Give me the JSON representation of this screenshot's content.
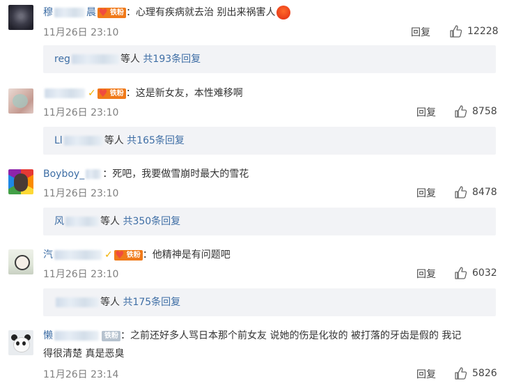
{
  "comments": [
    {
      "username": "穆",
      "username_tail": "晨",
      "fan_badge": "铁粉",
      "text": "：心理有疾病就去治 别出来祸害人",
      "time": "11月26日 23:10",
      "reply_label": "回复",
      "likes": "12228",
      "subreplies": {
        "who": "reg",
        "suffix": "等人",
        "link": "共193条回复"
      }
    },
    {
      "username": "",
      "fan_badge": "铁粉",
      "text": "：这是新女友，本性难移啊",
      "time": "11月26日 23:10",
      "reply_label": "回复",
      "likes": "8758",
      "subreplies": {
        "who": "Ll",
        "suffix": "等人",
        "link": "共165条回复"
      }
    },
    {
      "username": "Boyboy_",
      "text": "：死吧，我要做雪崩时最大的雪花",
      "time": "11月26日 23:10",
      "reply_label": "回复",
      "likes": "8478",
      "subreplies": {
        "who": "风",
        "suffix": "等人",
        "link": "共350条回复"
      }
    },
    {
      "username": "汽",
      "fan_badge": "铁粉",
      "text": "：他精神是有问题吧",
      "time": "11月26日 23:10",
      "reply_label": "回复",
      "likes": "6032",
      "subreplies": {
        "who": "",
        "suffix": "等人",
        "link": "共175条回复"
      }
    },
    {
      "username": "懒",
      "fan_badge": "铁粉",
      "text": "：之前还好多人骂日本那个前女友 说她的伤是化妆的 被打落的牙齿是假的 我记",
      "text_line2": "得很清楚 真是恶臭",
      "time": "11月26日 23:14",
      "reply_label": "回复",
      "likes": "5826"
    }
  ],
  "colors": {
    "link": "#3e6ea5",
    "meta": "#808080",
    "subreply_bg": "#f2f3f6",
    "fan_badge": "#f07a1a"
  },
  "icons": [
    "thumbs-up-icon",
    "heart-icon",
    "verified-icon",
    "angry-emoji-icon"
  ]
}
